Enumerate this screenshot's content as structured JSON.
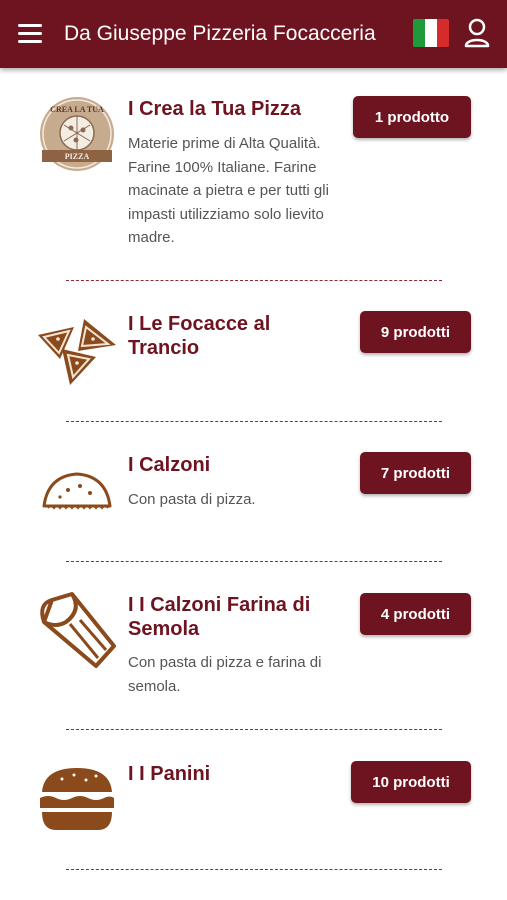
{
  "header": {
    "title": "Da Giuseppe Pizzeria Focacceria",
    "menu_icon": "hamburger-menu-icon",
    "language_icon": "italian-flag-icon",
    "user_icon": "user-account-icon"
  },
  "colors": {
    "brand": "#6e1420",
    "icon_brown": "#8b4a1c",
    "text_grey": "#555555"
  },
  "categories": [
    {
      "name": "I Crea la Tua Pizza",
      "description": "Materie prime di Alta Qualità. Farine 100% Italiane. Farine macinate a pietra e per tutti gli impasti utilizziamo solo lievito madre.",
      "count_label": "1 prodotto",
      "icon": "pizza-logo-icon",
      "icon_text_top": "CREA LA TUA",
      "icon_text_bottom": "PIZZA"
    },
    {
      "name": "I Le Focacce al Trancio",
      "description": "",
      "count_label": "9 prodotti",
      "icon": "focaccia-slices-icon"
    },
    {
      "name": "I Calzoni",
      "description": "Con pasta di pizza.",
      "count_label": "7 prodotti",
      "icon": "calzone-icon"
    },
    {
      "name": "I I Calzoni Farina di Semola",
      "description": "Con pasta di pizza e farina di semola.",
      "count_label": "4 prodotti",
      "icon": "wrap-icon"
    },
    {
      "name": "I I Panini",
      "description": "",
      "count_label": "10 prodotti",
      "icon": "burger-icon"
    }
  ]
}
